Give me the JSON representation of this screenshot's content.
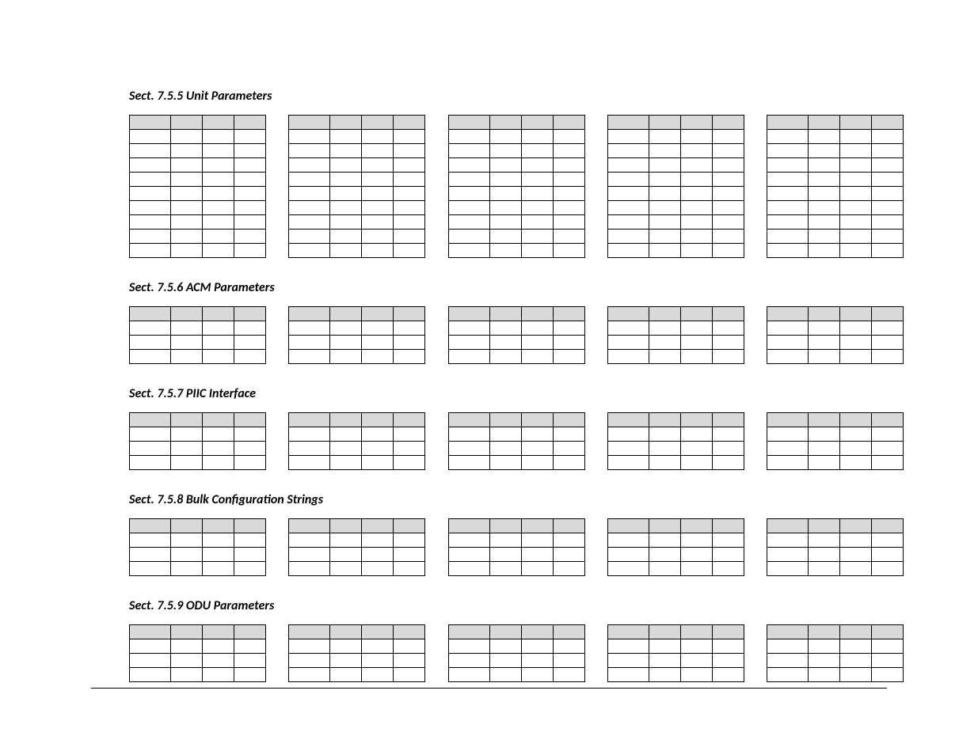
{
  "sections": [
    {
      "id": "755",
      "heading": "Sect. 7.5.5  Unit Parameters",
      "rows": 9,
      "tables": 5
    },
    {
      "id": "756",
      "heading": "Sect. 7.5.6 ACM Parameters",
      "rows": 3,
      "tables": 5
    },
    {
      "id": "757",
      "heading": "Sect. 7.5.7 PIIC Interface",
      "rows": 3,
      "tables": 5
    },
    {
      "id": "758",
      "heading": "Sect. 7.5.8 Bulk Configuration Strings",
      "rows": 3,
      "tables": 5
    },
    {
      "id": "759",
      "heading": "Sect. 7.5.9 ODU Parameters",
      "rows": 3,
      "tables": 5
    }
  ]
}
